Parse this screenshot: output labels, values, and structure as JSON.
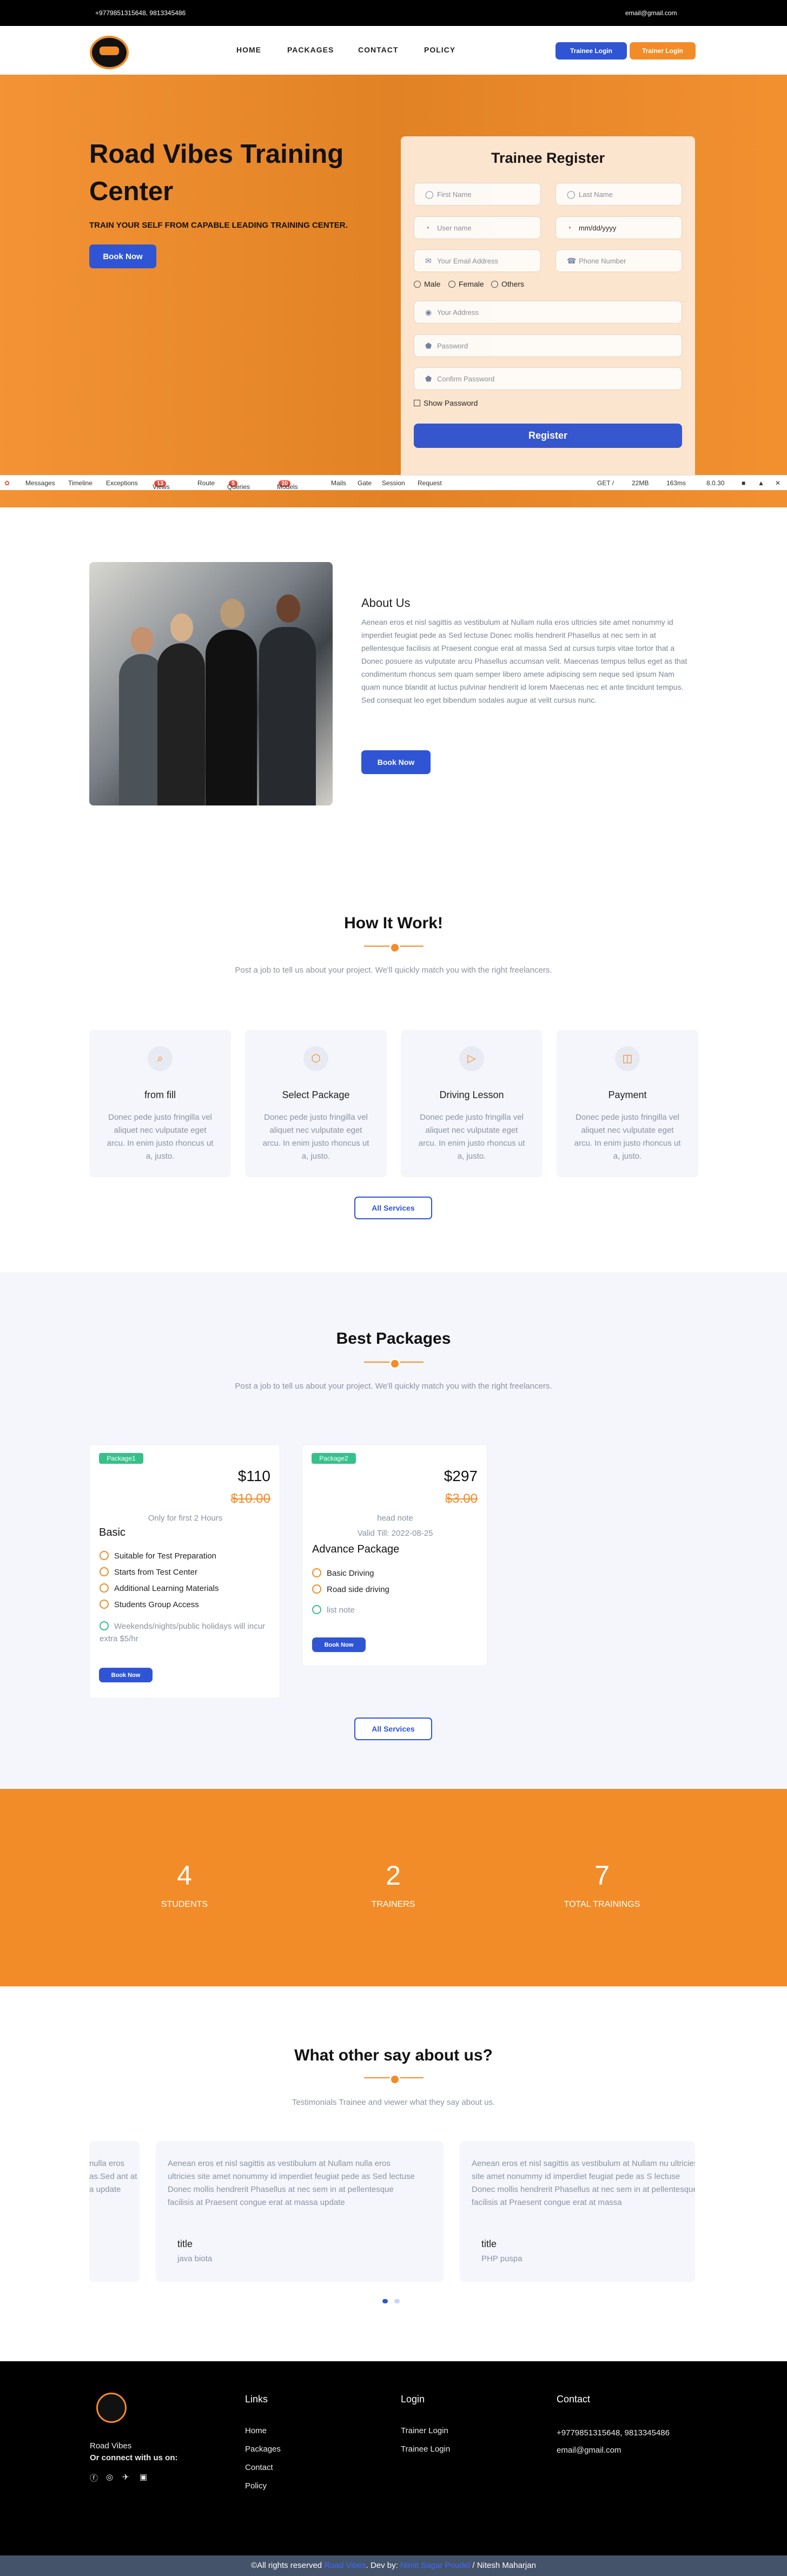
{
  "topbar": {
    "phone": "+9779851315648, 9813345486",
    "email": "email@gmail.com"
  },
  "nav": {
    "links": [
      "HOME",
      "PACKAGES",
      "CONTACT",
      "POLICY"
    ],
    "trainee_login": "Trainee Login",
    "trainer_login": "Trainer Login"
  },
  "hero": {
    "title": "Road Vibes Training Center",
    "subtitle": "TRAIN YOUR SELF FROM CAPABLE LEADING TRAINING CENTER.",
    "book_now": "Book Now"
  },
  "form": {
    "title": "Trainee Register",
    "first_name": "First Name",
    "last_name": "Last Name",
    "username": "User name",
    "date": "mm/dd/yyyy",
    "email": "Your Email Address",
    "phone": "Phone Number",
    "genders": [
      "Male",
      "Female",
      "Others"
    ],
    "address": "Your Address",
    "password": "Password",
    "confirm": "Confirm Password",
    "show_password": "Show Password",
    "register": "Register"
  },
  "debugbar": {
    "items": [
      "Messages",
      "Timeline",
      "Exceptions",
      "Views",
      "Route",
      "Queries",
      "Models",
      "Mails",
      "Gate",
      "Session",
      "Request"
    ],
    "views_count": "13",
    "queries_count": "5",
    "models_count": "20",
    "right": "GET /",
    "memory": "22MB",
    "time": "163ms",
    "version": "8.0.30"
  },
  "about": {
    "title": "About Us",
    "body": "Aenean eros et nisl sagittis as vestibulum at Nullam nulla eros ultricies site amet nonummy id imperdiet feugiat pede as Sed lectuse Donec mollis hendrerit Phasellus at nec sem in at pellentesque facilisis at Praesent congue erat at massa Sed at cursus turpis vitae tortor that a Donec posuere as vulputate arcu Phasellus accumsan velit. Maecenas tempus tellus eget as that condimentum rhoncus sem quam semper libero amete adipiscing sem neque sed ipsum Nam quam nunce blandit at luctus pulvinar hendrerit id lorem Maecenas nec et ante tincidunt tempus. Sed consequat leo eget bibendum sodales augue at velit cursus nunc.",
    "button": "Book Now"
  },
  "how": {
    "title": "How It Work!",
    "subtitle": "Post a job to tell us about your project. We'll quickly match you with the right freelancers.",
    "cards": [
      {
        "title": "from fill",
        "body": "Donec pede justo fringilla vel aliquet nec vulputate eget arcu. In enim justo rhoncus ut a, justo."
      },
      {
        "title": "Select Package",
        "body": "Donec pede justo fringilla vel aliquet nec vulputate eget arcu. In enim justo rhoncus ut a, justo."
      },
      {
        "title": "Driving Lesson",
        "body": "Donec pede justo fringilla vel aliquet nec vulputate eget arcu. In enim justo rhoncus ut a, justo."
      },
      {
        "title": "Payment",
        "body": "Donec pede justo fringilla vel aliquet nec vulputate eget arcu. In enim justo rhoncus ut a, justo."
      }
    ],
    "button": "All Services"
  },
  "packages": {
    "title": "Best Packages",
    "subtitle": "Post a job to tell us about your project. We'll quickly match you with the right freelancers.",
    "items": [
      {
        "tag": "Package1",
        "price": "$110",
        "old_price": "$10.00",
        "note": "Only for first 2 Hours",
        "title": "Basic",
        "features": [
          "Suitable for Test Preparation",
          "Starts from Test Center",
          "Additional Learning Materials",
          "Students Group Access"
        ],
        "extra": "Weekends/nights/public holidays will incur extra $5/hr",
        "button": "Book Now"
      },
      {
        "tag": "Package2",
        "price": "$297",
        "old_price": "$3.00",
        "note": "head note",
        "valid": "Valid Till: 2022-08-25",
        "title": "Advance Package",
        "features": [
          "Basic Driving",
          "Road side driving"
        ],
        "extra": "list note",
        "button": "Book Now"
      }
    ],
    "button": "All Services"
  },
  "stats": [
    {
      "number": "4",
      "label": "STUDENTS"
    },
    {
      "number": "2",
      "label": "TRAINERS"
    },
    {
      "number": "7",
      "label": "TOTAL TRAININGS"
    }
  ],
  "testimonials": {
    "title": "What other say about us?",
    "subtitle": "Testimonials Trainee and viewer what they say about us.",
    "partial_left": "nulla eros as.Sed ant at a update",
    "items": [
      {
        "quote": "Aenean eros et nisl sagittis as vestibulum at Nullam nulla eros ultricies site amet nonummy id imperdiet feugiat pede as Sed lectuse Donec mollis hendrerit Phasellus at nec sem in at pellentesque facilisis at Praesent congue erat at massa update",
        "name": "title",
        "role": "java biota"
      },
      {
        "quote": "Aenean eros et nisl sagittis as vestibulum at Nullam nu ultricies site amet nonummy id imperdiet feugiat pede as S lectuse Donec mollis hendrerit Phasellus at nec sem in at pellentesque facilisis at Praesent congue erat at massa",
        "name": "title",
        "role": "PHP puspa"
      }
    ]
  },
  "footer": {
    "brand": "Road Vibes",
    "connect": "Or connect with us on:",
    "links_title": "Links",
    "links": [
      "Home",
      "Packages",
      "Contact",
      "Policy"
    ],
    "login_title": "Login",
    "logins": [
      "Trainer Login",
      "Trainee Login"
    ],
    "contact_title": "Contact",
    "phone": "+9779851315648, 9813345486",
    "email": "email@gmail.com"
  },
  "copyright": {
    "prefix": "©All rights reserved",
    "brand": "Road Vibes",
    "dev": ". Dev by:",
    "dev_name": "Nimit Sagar Poudel",
    "suffix": "/ Nitesh Maharjan"
  }
}
